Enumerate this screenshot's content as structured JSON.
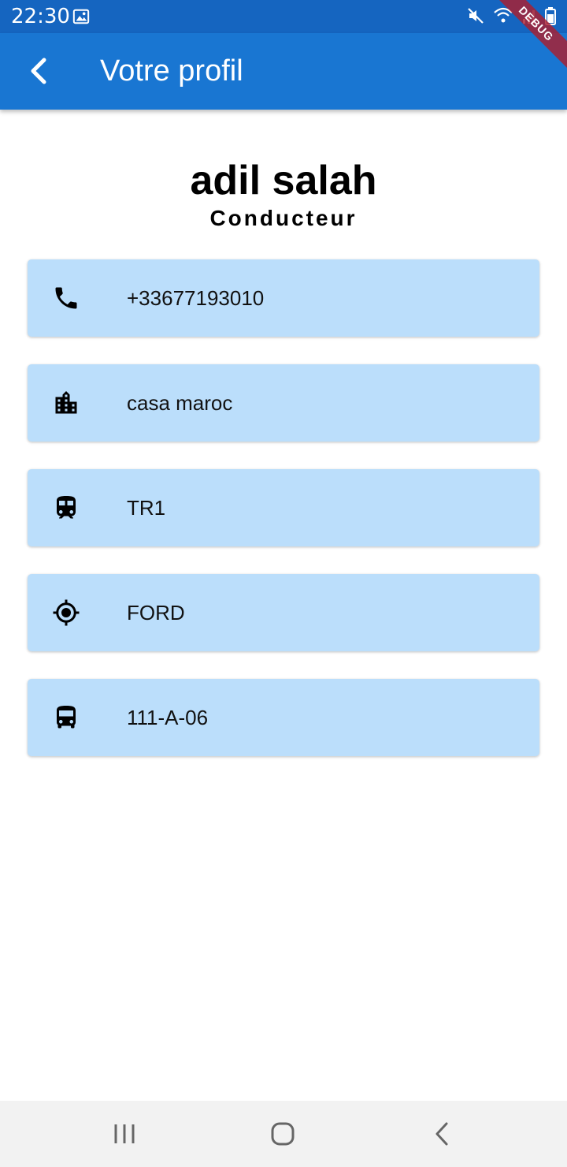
{
  "status_bar": {
    "time": "22:30",
    "icons": [
      "gallery-icon",
      "mute-icon",
      "wifi-icon",
      "signal-icon",
      "battery-icon"
    ]
  },
  "app_bar": {
    "title": "Votre profil",
    "back_icon": "arrow-back-icon",
    "debug_label": "DEBUG"
  },
  "profile": {
    "name": "adil salah",
    "role": "Conducteur"
  },
  "info_items": [
    {
      "icon": "phone-icon",
      "value": "+33677193010"
    },
    {
      "icon": "city-icon",
      "value": "casa maroc"
    },
    {
      "icon": "train-icon",
      "value": "TR1"
    },
    {
      "icon": "gps-target-icon",
      "value": "FORD"
    },
    {
      "icon": "bus-icon",
      "value": "111-A-06"
    }
  ],
  "nav_bar": {
    "buttons": [
      "recent-apps-icon",
      "home-icon",
      "back-icon"
    ]
  },
  "colors": {
    "status_bar": "#1565c0",
    "app_bar": "#1976d2",
    "card_background": "#bbdefb"
  }
}
